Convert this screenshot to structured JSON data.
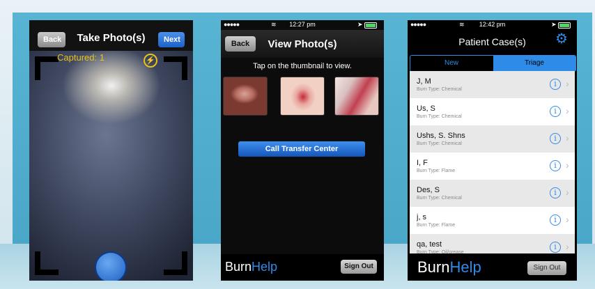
{
  "camera": {
    "back_label": "Back",
    "title": "Take Photo(s)",
    "next_label": "Next",
    "captured_text": "Captured: 1"
  },
  "view": {
    "status": {
      "time": "12:27 pm"
    },
    "back_label": "Back",
    "title": "View Photo(s)",
    "hint": "Tap on the thumbnail to view.",
    "call_label": "Call Transfer Center",
    "brand_a": "Burn",
    "brand_b": "Help",
    "signout_label": "Sign Out"
  },
  "cases": {
    "status": {
      "time": "12:42 pm"
    },
    "title": "Patient Case(s)",
    "tabs": [
      {
        "label": "New"
      },
      {
        "label": "Triage"
      }
    ],
    "rows": [
      {
        "name": "J, M",
        "burn_type": "Burn Type: Chemical"
      },
      {
        "name": "Us, S",
        "burn_type": "Burn Type: Chemical"
      },
      {
        "name": "Ushs, S. Shns",
        "burn_type": "Burn Type: Chemical"
      },
      {
        "name": "I, F",
        "burn_type": "Burn Type: Flame"
      },
      {
        "name": "Des, S",
        "burn_type": "Burn Type: Chemical"
      },
      {
        "name": "j, s",
        "burn_type": "Burn Type: Flame"
      },
      {
        "name": "qa, test",
        "burn_type": "Burn Type: Oil/grease"
      }
    ],
    "brand_a": "Burn",
    "brand_b": "Help",
    "signout_label": "Sign Out"
  },
  "colors": {
    "accent": "#2f8be8",
    "panel": "#4aa7c8",
    "captured": "#e8c21a"
  }
}
